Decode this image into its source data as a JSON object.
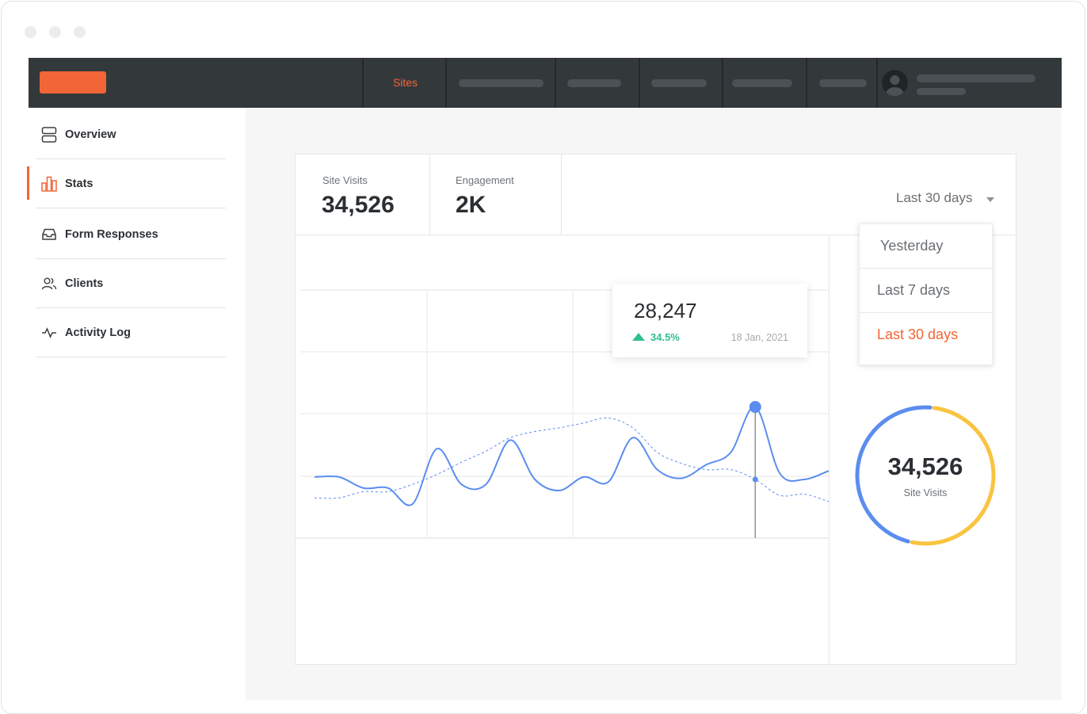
{
  "window": {
    "controls": [
      "close",
      "minimize",
      "maximize"
    ]
  },
  "topbar": {
    "logo": "logo",
    "nav_active": "Sites",
    "accent_color": "#f26536",
    "bg_color": "#33383b"
  },
  "sidebar": {
    "items": [
      {
        "label": "Overview",
        "icon": "server-icon",
        "active": false
      },
      {
        "label": "Stats",
        "icon": "bar-chart-icon",
        "active": true
      },
      {
        "label": "Form Responses",
        "icon": "inbox-icon",
        "active": false
      },
      {
        "label": "Clients",
        "icon": "users-icon",
        "active": false
      },
      {
        "label": "Activity Log",
        "icon": "activity-icon",
        "active": false
      }
    ]
  },
  "stats": {
    "site_visits_label": "Site Visits",
    "site_visits_value": "34,526",
    "engagement_label": "Engagement",
    "engagement_value": "2K"
  },
  "period": {
    "selected": "Last 30 days",
    "options": [
      "Yesterday",
      "Last 7 days",
      "Last 30 days"
    ]
  },
  "tooltip": {
    "value": "28,247",
    "change": "34.5%",
    "date": "18 Jan, 2021",
    "change_color": "#2fbf8f"
  },
  "donut": {
    "value": "34,526",
    "label": "Site Visits",
    "segments": [
      {
        "fraction": 0.52,
        "color": "#f9c440"
      },
      {
        "fraction": 0.48,
        "color": "#5b8def"
      }
    ]
  },
  "chart_data": {
    "type": "line",
    "title": "",
    "xlabel": "",
    "ylabel": "",
    "grid": true,
    "x": [
      0,
      1,
      2,
      3,
      4,
      5,
      6,
      7,
      8,
      9,
      10,
      11,
      12,
      13,
      14,
      15,
      16,
      17,
      18,
      19,
      20,
      21
    ],
    "series": [
      {
        "style": "solid",
        "color": "#5b8def",
        "values": [
          22,
          22,
          13,
          13,
          0,
          45,
          16,
          16,
          52,
          20,
          11,
          22,
          18,
          54,
          28,
          21,
          32,
          42,
          79,
          25,
          20,
          27
        ]
      },
      {
        "style": "dashed",
        "color": "#5b8def",
        "values": [
          5,
          5,
          10,
          10,
          16,
          24,
          34,
          43,
          54,
          59,
          62,
          66,
          70,
          62,
          42,
          33,
          28,
          28,
          20,
          7,
          8,
          2
        ]
      }
    ],
    "highlight_index": 18
  }
}
